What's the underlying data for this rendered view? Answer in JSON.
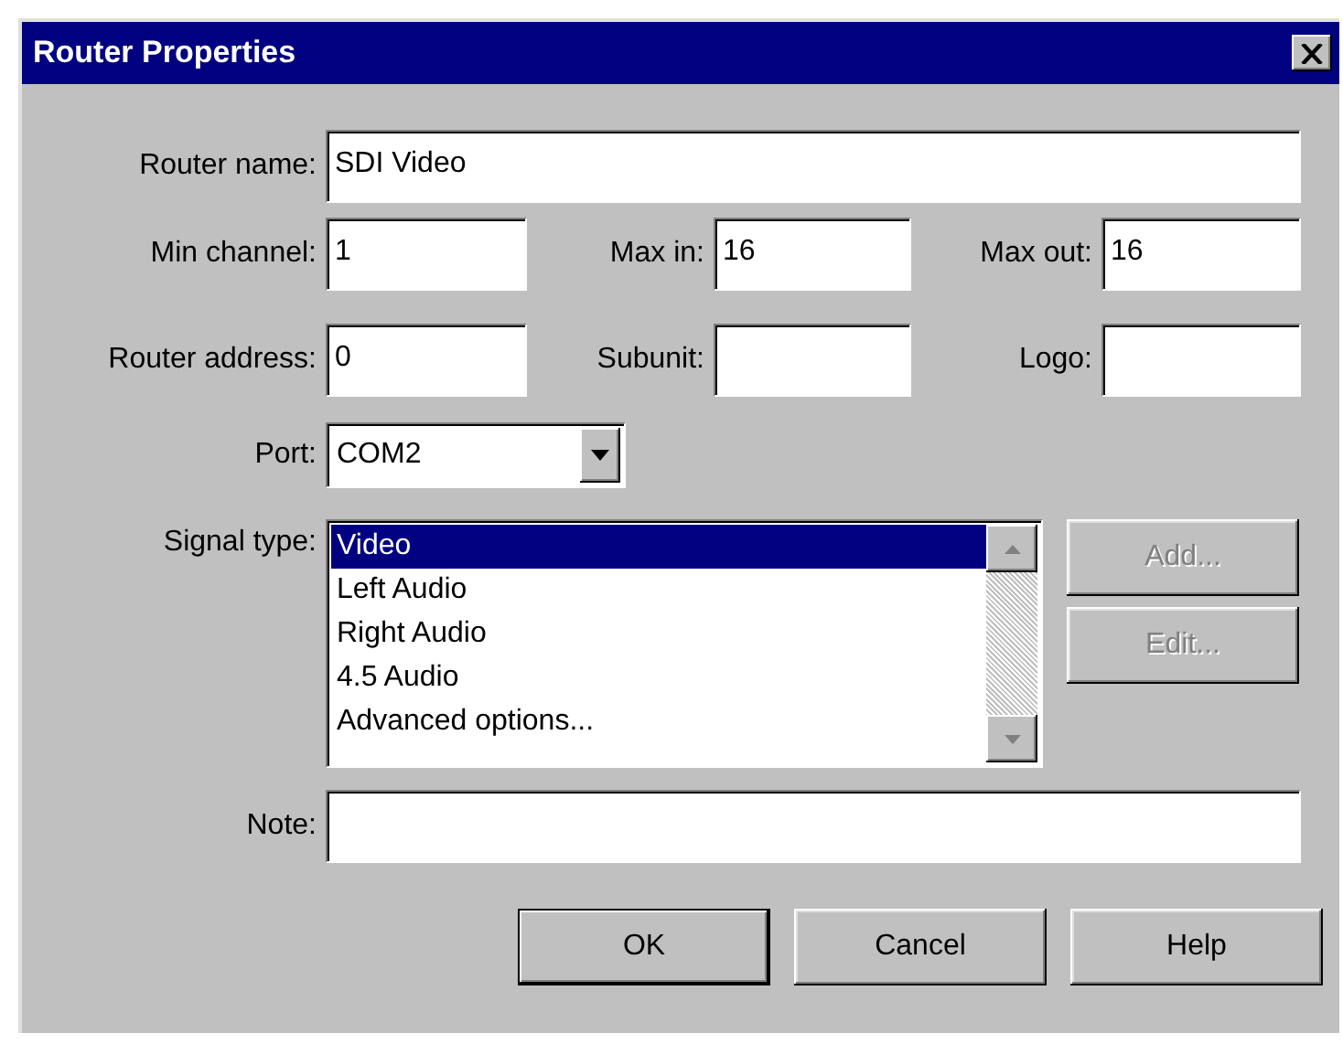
{
  "window": {
    "title": "Router Properties"
  },
  "router_name": {
    "label": "Router name:",
    "value": "SDI Video"
  },
  "channel_row": [
    {
      "label": "Min channel:",
      "value": "1"
    },
    {
      "label": "Max in:",
      "value": "16"
    },
    {
      "label": "Max out:",
      "value": "16"
    }
  ],
  "address_row": [
    {
      "label": "Router address:",
      "value": "0"
    },
    {
      "label": "Subunit:"
    },
    {
      "label": "Logo:"
    }
  ],
  "port": {
    "label": "Port:",
    "value": "COM2"
  },
  "signal_type": {
    "label": "Signal type:",
    "items": [
      {
        "label": "Video",
        "selected": true
      },
      {
        "label": "Left Audio",
        "selected": false
      },
      {
        "label": "Right Audio",
        "selected": false
      },
      {
        "label": "4.5 Audio",
        "selected": false
      },
      {
        "label": "Advanced options...",
        "selected": false
      }
    ]
  },
  "side_buttons": [
    {
      "label": "Add...",
      "disabled": true
    },
    {
      "label": "Edit...",
      "disabled": true
    }
  ],
  "note": {
    "label": "Note:"
  },
  "buttons": [
    {
      "label": "OK",
      "default": true
    },
    {
      "label": "Cancel",
      "default": false
    },
    {
      "label": "Help",
      "default": false
    }
  ]
}
